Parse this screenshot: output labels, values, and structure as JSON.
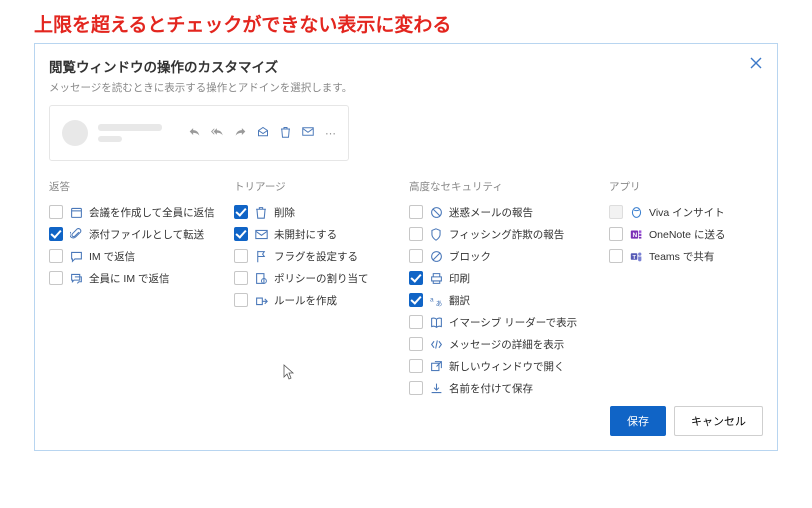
{
  "annotation": "上限を超えるとチェックができない表示に変わる",
  "dialog": {
    "title": "閲覧ウィンドウの操作のカスタマイズ",
    "subtitle": "メッセージを読むときに表示する操作とアドインを選択します。"
  },
  "columns": {
    "reply": {
      "header": "返答",
      "items": [
        {
          "label": "会議を作成して全員に返信",
          "checked": false
        },
        {
          "label": "添付ファイルとして転送",
          "checked": true
        },
        {
          "label": "IM で返信",
          "checked": false
        },
        {
          "label": "全員に IM で返信",
          "checked": false
        }
      ]
    },
    "triage": {
      "header": "トリアージ",
      "items": [
        {
          "label": "削除",
          "checked": true
        },
        {
          "label": "未開封にする",
          "checked": true
        },
        {
          "label": "フラグを設定する",
          "checked": false
        },
        {
          "label": "ポリシーの割り当て",
          "checked": false
        },
        {
          "label": "ルールを作成",
          "checked": false
        }
      ]
    },
    "security": {
      "header": "高度なセキュリティ",
      "items": [
        {
          "label": "迷惑メールの報告",
          "checked": false
        },
        {
          "label": "フィッシング詐欺の報告",
          "checked": false
        },
        {
          "label": "ブロック",
          "checked": false
        },
        {
          "label": "印刷",
          "checked": true
        },
        {
          "label": "翻訳",
          "checked": true
        },
        {
          "label": "イマーシブ リーダーで表示",
          "checked": false
        },
        {
          "label": "メッセージの詳細を表示",
          "checked": false
        },
        {
          "label": "新しいウィンドウで開く",
          "checked": false
        },
        {
          "label": "名前を付けて保存",
          "checked": false
        }
      ]
    },
    "apps": {
      "header": "アプリ",
      "items": [
        {
          "label": "Viva インサイト",
          "checked": false,
          "disabled": true
        },
        {
          "label": "OneNote に送る",
          "checked": false
        },
        {
          "label": "Teams で共有",
          "checked": false
        }
      ]
    }
  },
  "footer": {
    "save": "保存",
    "cancel": "キャンセル"
  }
}
